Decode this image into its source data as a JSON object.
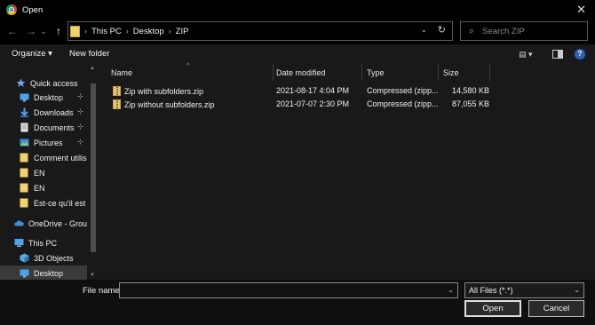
{
  "window": {
    "title": "Open",
    "close_glyph": "✕"
  },
  "nav": {
    "back": "←",
    "forward": "→",
    "recent": "⌄",
    "up": "↑",
    "breadcrumbs": [
      "This PC",
      "Desktop",
      "ZIP"
    ],
    "separator": "›",
    "refresh": "↻",
    "dropdown": "⌄"
  },
  "search": {
    "placeholder": "Search ZIP",
    "icon": "⌕"
  },
  "toolbar": {
    "organize": "Organize ▾",
    "new_folder": "New folder",
    "view": "▤ ▾",
    "help": "?"
  },
  "sidebar": {
    "items": [
      {
        "label": "Quick access",
        "icon": "star-icon",
        "pinned": false
      },
      {
        "label": "Desktop",
        "icon": "desktop-icon",
        "pinned": true
      },
      {
        "label": "Downloads",
        "icon": "download-icon",
        "pinned": true
      },
      {
        "label": "Documents",
        "icon": "documents-icon",
        "pinned": true
      },
      {
        "label": "Pictures",
        "icon": "pictures-icon",
        "pinned": true
      },
      {
        "label": "Comment utilise",
        "icon": "folder-icon",
        "pinned": false
      },
      {
        "label": "EN",
        "icon": "folder-icon",
        "pinned": false
      },
      {
        "label": "EN",
        "icon": "folder-icon",
        "pinned": false
      },
      {
        "label": "Est-ce qu'il est p",
        "icon": "folder-icon",
        "pinned": false
      },
      {
        "label": "OneDrive - Group",
        "icon": "cloud-icon",
        "pinned": false
      },
      {
        "label": "This PC",
        "icon": "computer-icon",
        "pinned": false
      },
      {
        "label": "3D Objects",
        "icon": "cube-icon",
        "pinned": false
      },
      {
        "label": "Desktop",
        "icon": "desktop-icon",
        "pinned": false,
        "selected": true
      }
    ],
    "pin_glyph": "📌"
  },
  "columns": {
    "name": "Name",
    "date": "Date modified",
    "type": "Type",
    "size": "Size",
    "sort": "^"
  },
  "files": [
    {
      "name": "Zip with subfolders.zip",
      "date": "2021-08-17 4:04 PM",
      "type": "Compressed (zipp...",
      "size": "14,580 KB"
    },
    {
      "name": "Zip without subfolders.zip",
      "date": "2021-07-07 2:30 PM",
      "type": "Compressed (zipp...",
      "size": "87,055 KB"
    }
  ],
  "footer": {
    "file_name_label": "File name:",
    "file_name_value": "",
    "file_type": "All Files (*.*)",
    "dropdown": "⌄",
    "open": "Open",
    "cancel": "Cancel"
  }
}
